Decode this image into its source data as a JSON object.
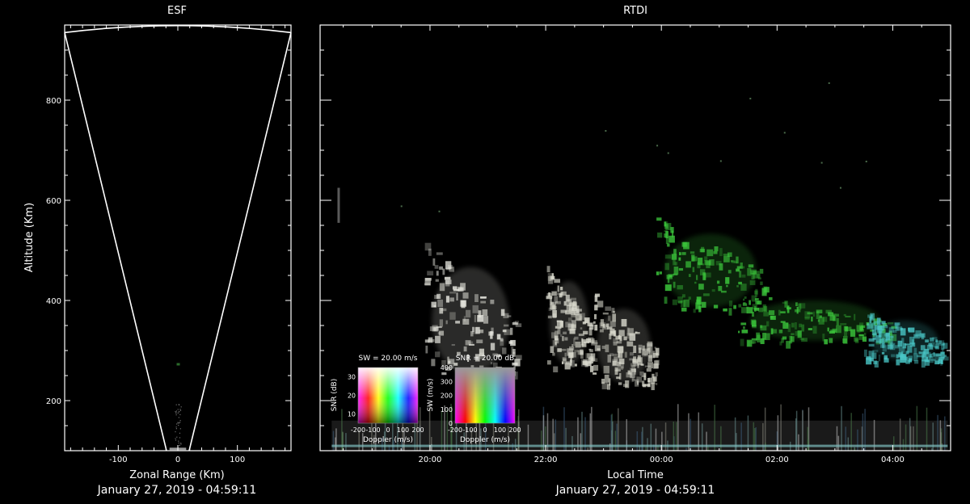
{
  "colors": {
    "background": "#000000",
    "frame": "#ffffff",
    "echo_white": "#e8e8e0",
    "echo_green": "#3cc83c",
    "echo_cyan": "#4ac8c8"
  },
  "chart_data": [
    {
      "type": "heatmap",
      "title": "ESF",
      "xlabel": "Zonal Range (Km)",
      "ylabel": "Altitude (Km)",
      "xlim": [
        -190,
        190
      ],
      "ylim": [
        100,
        950
      ],
      "x_ticks": [
        -100,
        0,
        100
      ],
      "y_ticks": [
        200,
        400,
        600,
        800
      ],
      "timestamp": "January 27, 2019 - 04:59:11",
      "beam": {
        "apex_x": 0,
        "apex_y": 100,
        "upper_left": [
          -190,
          935
        ],
        "upper_right": [
          190,
          935
        ],
        "top_y": 950
      }
    },
    {
      "type": "heatmap",
      "title": "RTDI",
      "xlabel": "Local Time",
      "ylabel": "",
      "x_ticks": [
        "20:00",
        "22:00",
        "00:00",
        "02:00",
        "04:00"
      ],
      "xlim_hours": [
        18.1,
        29.0
      ],
      "ylim": [
        100,
        950
      ],
      "timestamp": "January 27, 2019 - 04:59:11",
      "echo_plumes": [
        {
          "t_start": 19.9,
          "t_end": 21.5,
          "alt_low": 200,
          "alt_high": 520,
          "color": "#e8e8e0"
        },
        {
          "t_start": 22.0,
          "t_end": 22.8,
          "alt_low": 230,
          "alt_high": 480,
          "color": "#dcdcd0"
        },
        {
          "t_start": 22.8,
          "t_end": 23.9,
          "alt_low": 200,
          "alt_high": 420,
          "color": "#d8d8cc"
        },
        {
          "t_start": 23.9,
          "t_end": 25.8,
          "alt_low": 350,
          "alt_high": 570,
          "color": "#3cc83c"
        },
        {
          "t_start": 25.3,
          "t_end": 28.0,
          "alt_low": 300,
          "alt_high": 420,
          "color": "#3cc83c"
        },
        {
          "t_start": 27.5,
          "t_end": 28.9,
          "alt_low": 260,
          "alt_high": 380,
          "color": "#4ac8c8"
        }
      ],
      "colorbars": [
        {
          "title": "SW = 20.00 m/s",
          "xlabel": "Doppler (m/s)",
          "ylabel": "SNR (dB)",
          "x_ticks": [
            "-200",
            "-100",
            "0",
            "100",
            "200"
          ],
          "y_ticks": [
            "10",
            "20",
            "30"
          ]
        },
        {
          "title": "SNR = 20.00 dB",
          "xlabel": "Doppler (m/s)",
          "ylabel": "SW (m/s)",
          "x_ticks": [
            "-200",
            "-100",
            "0",
            "100",
            "200"
          ],
          "y_ticks": [
            "0",
            "100",
            "200",
            "300",
            "400"
          ]
        }
      ]
    }
  ]
}
